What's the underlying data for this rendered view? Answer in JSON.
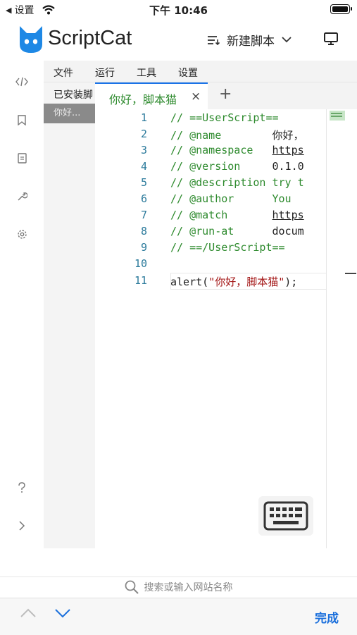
{
  "status_bar": {
    "back_label": "设置",
    "time": "下午 10:46"
  },
  "header": {
    "brand": "ScriptCat",
    "new_script_label": "新建脚本"
  },
  "menu": [
    "文件",
    "运行",
    "工具",
    "设置"
  ],
  "file_panel": {
    "installed_label": "已安装脚",
    "script_entry": "你好..."
  },
  "tab": {
    "title": "你好，脚本猫",
    "close": "×",
    "add": "+"
  },
  "editor": {
    "line_numbers": [
      "1",
      "2",
      "3",
      "4",
      "5",
      "6",
      "7",
      "8",
      "9",
      "10",
      "11"
    ],
    "lines": [
      {
        "key": "// ==UserScript==",
        "value": ""
      },
      {
        "key": "// @name        ",
        "value": "你好，"
      },
      {
        "key": "// @namespace   ",
        "value": "https"
      },
      {
        "key": "// @version     ",
        "value": "0.1.0"
      },
      {
        "key": "// @description ",
        "value": "try t"
      },
      {
        "key": "// @author      ",
        "value": "You"
      },
      {
        "key": "// @match       ",
        "value": "https"
      },
      {
        "key": "// @run-at      ",
        "value": "docum"
      },
      {
        "key": "// ==/UserScript==",
        "value": ""
      },
      {
        "key": "",
        "value": ""
      },
      {
        "fn": "alert(",
        "str": "\"你好，脚本猫\"",
        "end": ");"
      }
    ]
  },
  "address_bar": {
    "placeholder": "搜索或输入网站名称"
  },
  "keyboard_toolbar": {
    "done_label": "完成"
  },
  "colors": {
    "accent": "#1a73e8",
    "comment": "#2d8a2d",
    "line_number": "#2b7a9b",
    "string": "#a31515",
    "logo": "#1e88e5"
  }
}
